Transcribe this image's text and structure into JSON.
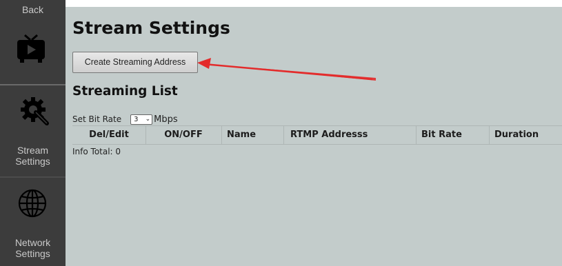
{
  "sidebar": {
    "back_label": "Back",
    "items": [
      {
        "label_line1": "",
        "label_line2": "",
        "icon": "tv-play-icon"
      },
      {
        "label_line1": "Stream",
        "label_line2": "Settings",
        "icon": "gear-wrench-icon"
      },
      {
        "label_line1": "Network",
        "label_line2": "Settings",
        "icon": "globe-icon"
      }
    ]
  },
  "main": {
    "title": "Stream Settings",
    "create_button_label": "Create Streaming Address",
    "list_title": "Streaming List",
    "bitrate": {
      "label": "Set Bit Rate",
      "selected": "3",
      "unit": "Mbps"
    },
    "table": {
      "columns": [
        "Del/Edit",
        "ON/OFF",
        "Name",
        "RTMP Addresss",
        "Bit Rate",
        "Duration"
      ]
    },
    "info_total": "Info Total: 0"
  },
  "colors": {
    "sidebar_bg": "#3c3c3c",
    "content_bg": "#c3cccb",
    "annotation_arrow": "#e32b2b"
  }
}
